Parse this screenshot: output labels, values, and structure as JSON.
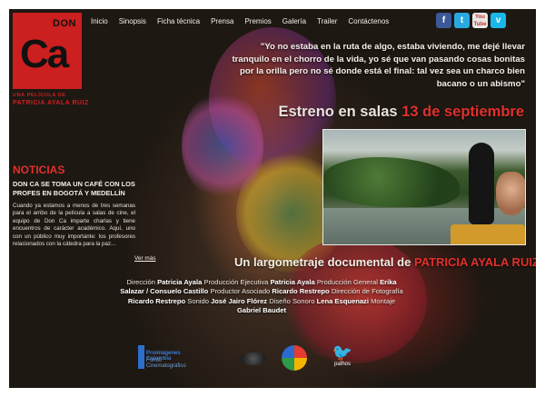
{
  "site": {
    "logo": {
      "top_word": "DON",
      "main_word": "Ca",
      "tagline": "UNA PELÍCULA DE",
      "director": "PATRICIA AYALA RUIZ"
    },
    "nav": [
      {
        "label": "Inicio"
      },
      {
        "label": "Sinopsis"
      },
      {
        "label": "Ficha técnica"
      },
      {
        "label": "Prensa"
      },
      {
        "label": "Premios"
      },
      {
        "label": "Galería"
      },
      {
        "label": "Trailer"
      },
      {
        "label": "Contáctenos"
      }
    ],
    "social": [
      {
        "name": "facebook-icon",
        "glyph": "f",
        "color": "#3b5998"
      },
      {
        "name": "twitter-icon",
        "glyph": "t",
        "color": "#2aa9e0"
      },
      {
        "name": "youtube-icon",
        "glyph": "You Tube",
        "color": "#c4302b"
      },
      {
        "name": "vimeo-icon",
        "glyph": "v",
        "color": "#1ab7ea"
      }
    ]
  },
  "hero": {
    "quote": "\"Yo no estaba en la ruta de algo, estaba viviendo, me dejé llevar tranquilo en el chorro de la vida, yo sé que van pasando cosas bonitas por la orilla pero no sé donde está el final: tal vez sea un charco bien bacano o un abismo\"",
    "release_prefix": "Estreno en salas ",
    "release_date": "13 de septiembre"
  },
  "news": {
    "heading": "NOTICIAS",
    "title": "DON CA SE TOMA UN CAFÉ CON LOS PROFES EN BOGOTÁ Y MEDELLÍN",
    "body": "Cuando ya estamos a menos de tres semanas para el arribo de la película a salas de cine, el equipo de Don Ca imparte charlas y tiene encuentros de carácter académico. Aquí, uno con un público muy importante: los profesores relacionados con la cátedra para la paz...",
    "more_label": "Ver más"
  },
  "credits": {
    "subtitle_prefix": "Un largometraje documental de ",
    "subtitle_director": "PATRICIA AYALA RUIZ",
    "lines": [
      [
        {
          "role": "Dirección ",
          "name": "Patricia Ayala"
        },
        {
          "role": " Producción Ejecutiva ",
          "name": "Patricia Ayala"
        },
        {
          "role": " Producción General ",
          "name": "Erika"
        }
      ],
      [
        {
          "role": "",
          "name": "Salazar / Consuelo Castillo"
        },
        {
          "role": " Productor Asociado ",
          "name": "Ricardo Restrepo"
        },
        {
          "role": " Dirección de Fotografía",
          "name": ""
        }
      ],
      [
        {
          "role": "",
          "name": "Ricardo Restrepo"
        },
        {
          "role": " Sonido ",
          "name": "José Jairo Flórez"
        },
        {
          "role": " Diseño Sonoro ",
          "name": "Lena Esquenazi"
        },
        {
          "role": " Montaje",
          "name": ""
        }
      ],
      [
        {
          "role": "",
          "name": "Gabriel Baudet"
        }
      ]
    ]
  },
  "sponsors": {
    "first_line1": "Proimágenes Colombia",
    "first_line2": "Fondo Cinematográfico",
    "last_label": "pathos"
  }
}
